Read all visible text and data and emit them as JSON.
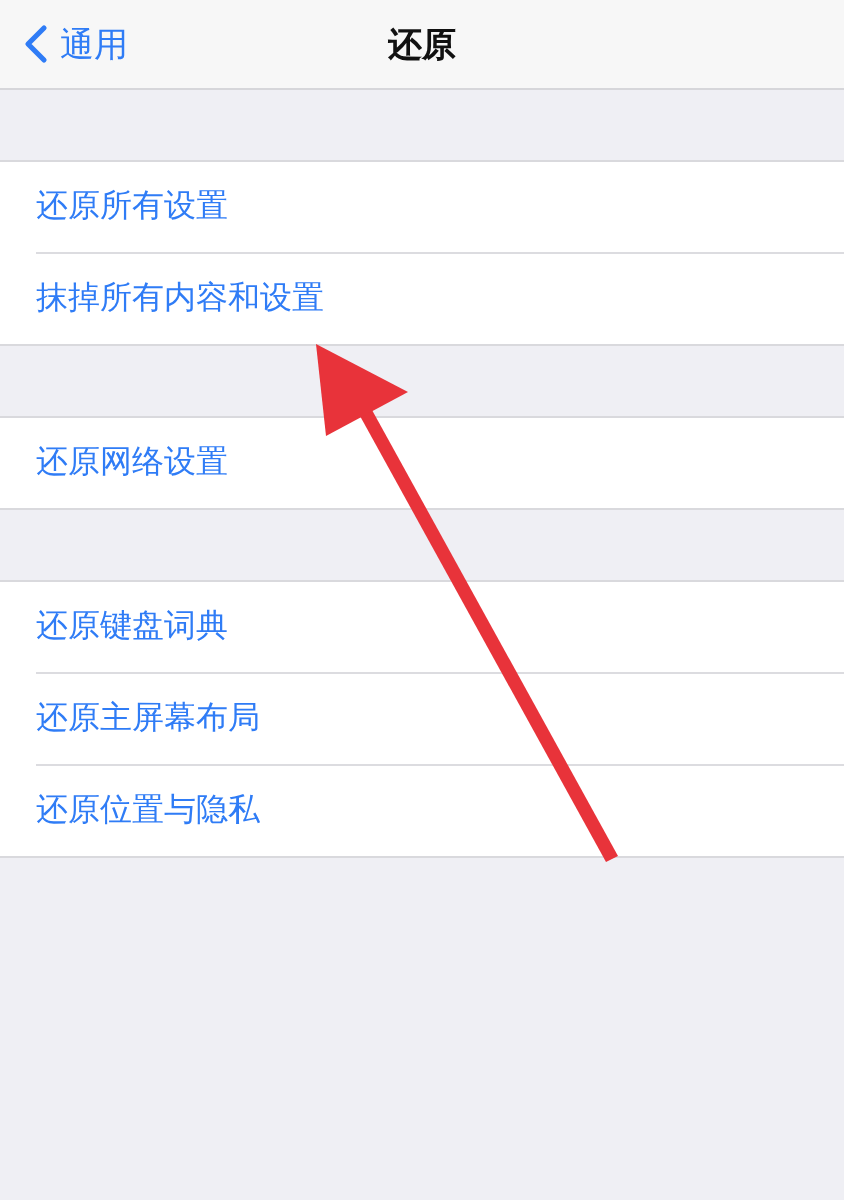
{
  "nav_bar": {
    "back_label": "通用",
    "title": "还原"
  },
  "groups": [
    {
      "items": [
        {
          "label": "还原所有设置"
        },
        {
          "label": "抹掉所有内容和设置"
        }
      ]
    },
    {
      "items": [
        {
          "label": "还原网络设置"
        }
      ]
    },
    {
      "items": [
        {
          "label": "还原键盘词典"
        },
        {
          "label": "还原主屏幕布局"
        },
        {
          "label": "还原位置与隐私"
        }
      ]
    }
  ],
  "annotation": {
    "kind": "arrow"
  }
}
